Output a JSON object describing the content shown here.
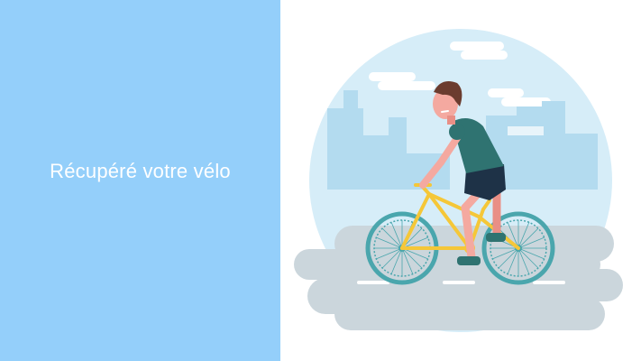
{
  "slide": {
    "title": "Récupéré votre vélo"
  },
  "illustration": {
    "subject": "cyclist-riding-bicycle",
    "colors": {
      "left_panel_bg": "#94cffa",
      "sky_circle": "#d6edf8",
      "city_silhouette": "#b3dbef",
      "road": "#cbd6dc",
      "bike_frame": "#f5c738",
      "wheel": "#4aa6ad",
      "shirt": "#2f7371",
      "shorts": "#1e3247",
      "skin": "#f4a9a0",
      "hair": "#6b3c2f"
    }
  }
}
